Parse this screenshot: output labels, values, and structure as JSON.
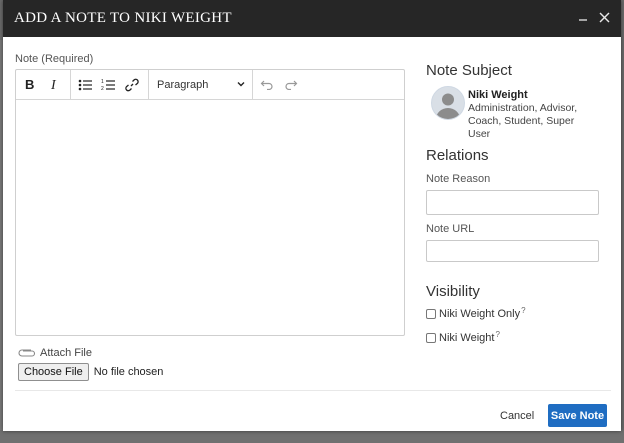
{
  "modal": {
    "title": "ADD A NOTE TO NIKI WEIGHT"
  },
  "note": {
    "label": "Note (Required)",
    "block_format": "Paragraph"
  },
  "attachment": {
    "label": "Attach File",
    "button": "Choose File",
    "status": "No file chosen"
  },
  "subject": {
    "heading": "Note Subject",
    "name": "Niki Weight",
    "roles": "Administration, Advisor, Coach, Student, Super User"
  },
  "relations": {
    "heading": "Relations",
    "reason_label": "Note Reason",
    "reason_value": "",
    "url_label": "Note URL",
    "url_value": ""
  },
  "visibility": {
    "heading": "Visibility",
    "options": [
      {
        "label": "Niki Weight Only",
        "hint": "?",
        "checked": false
      },
      {
        "label": "Niki Weight",
        "hint": "?",
        "checked": false
      }
    ]
  },
  "footer": {
    "cancel": "Cancel",
    "save": "Save Note"
  },
  "colors": {
    "header_bg": "#262626",
    "primary_button": "#1f6dc2"
  }
}
